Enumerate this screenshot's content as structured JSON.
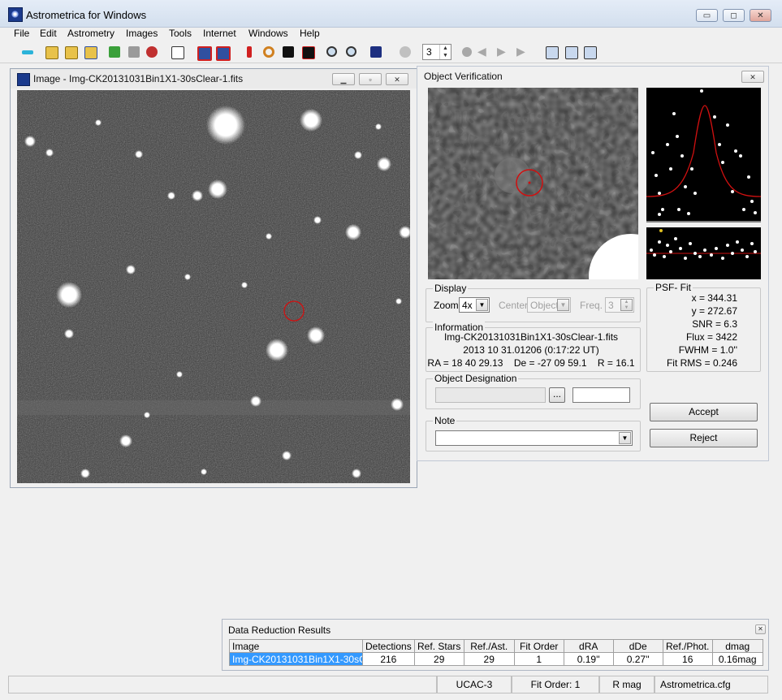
{
  "app": {
    "title": "Astrometrica for Windows"
  },
  "window_controls": {
    "minimize": "▭",
    "maximize": "◻",
    "close": "✕"
  },
  "menu": [
    "File",
    "Edit",
    "Astrometry",
    "Images",
    "Tools",
    "Internet",
    "Windows",
    "Help"
  ],
  "toolbar": {
    "frame_spin_value": "3"
  },
  "image_window": {
    "title": "Image - Img-CK20131031Bin1X1-30sClear-1.fits"
  },
  "verification": {
    "title": "Object Verification",
    "display": {
      "legend": "Display",
      "zoom_label": "Zoom",
      "zoom_value": "4x",
      "center_label": "Center",
      "center_value": "Object",
      "freq_label": "Freq.",
      "freq_value": "3"
    },
    "psf": {
      "legend": "PSF- Fit",
      "lines": [
        "x = 344.31",
        "y = 272.67",
        "SNR = 6.3",
        "Flux = 3422",
        "FWHM = 1.0''",
        "Fit RMS = 0.246"
      ]
    },
    "information": {
      "legend": "Information",
      "lines": [
        "Img-CK20131031Bin1X1-30sClear-1.fits",
        "2013 10 31.01206 (0:17:22 UT)",
        "RA = 18 40 29.13    De = -27 09 59.1    R = 16.1"
      ]
    },
    "designation": {
      "legend": "Object Designation",
      "browse": "..."
    },
    "note": {
      "legend": "Note"
    },
    "accept": "Accept",
    "reject": "Reject"
  },
  "results": {
    "title": "Data Reduction Results",
    "headers": [
      "Image",
      "Detections",
      "Ref. Stars",
      "Ref./Ast.",
      "Fit Order",
      "dRA",
      "dDe",
      "Ref./Phot.",
      "dmag"
    ],
    "row": [
      "Img-CK20131031Bin1X1-30sClear",
      "216",
      "29",
      "29",
      "1",
      "0.19''",
      "0.27''",
      "16",
      "0.16mag"
    ]
  },
  "statusbar": [
    "UCAC-3",
    "Fit Order: 1",
    "R mag",
    "Astrometrica.cfg"
  ]
}
